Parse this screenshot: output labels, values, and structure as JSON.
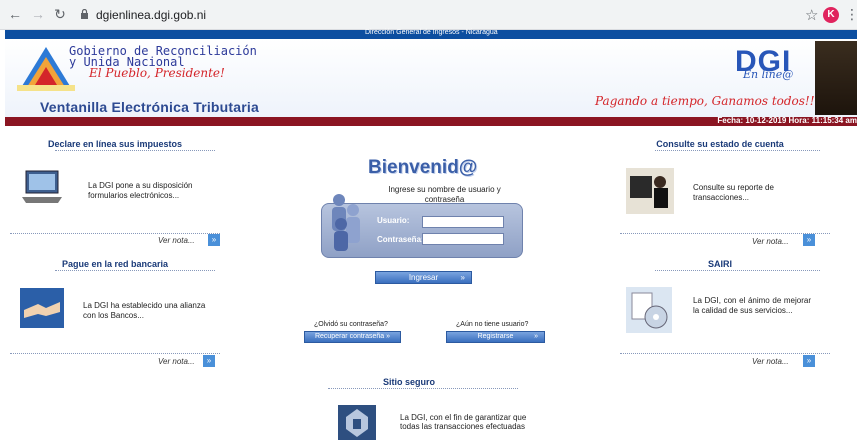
{
  "browser": {
    "url": "dgienlinea.dgi.gob.ni",
    "profile_initial": "K"
  },
  "site": {
    "top_strip": "Dirección General de Ingresos - Nicaragua",
    "gov_line1": "Gobierno de Reconciliación",
    "gov_line2": "y Unida Nacional",
    "gov_line3": "El Pueblo, Presidente!",
    "portal_title": "Ventanilla Electrónica Tributaria",
    "dgi_logo": "DGI",
    "dgi_sub": "En line@",
    "slogan": "Pagando a tiempo, Ganamos todos!!",
    "date_line": "Fecha: 10-12-2019 Hora: 11:15:34 am"
  },
  "left": {
    "box1": {
      "title": "Declare en línea sus impuestos",
      "desc": "La DGI pone a su disposición formularios electrónicos...",
      "more": "Ver nota..."
    },
    "box2": {
      "title": "Pague en la red bancaria",
      "desc": "La DGI ha establecido una alianza con los Bancos...",
      "more": "Ver nota..."
    }
  },
  "right": {
    "box1": {
      "title": "Consulte su estado de cuenta",
      "desc": "Consulte su reporte de transacciones...",
      "more": "Ver nota..."
    },
    "box2": {
      "title": "SAIRI",
      "desc": "La DGI, con el ánimo de mejorar la calidad de sus servicios...",
      "more": "Ver nota..."
    }
  },
  "login": {
    "title": "Bienvenid@",
    "hint": "Ingrese su nombre de usuario y contraseña",
    "user_label": "Usuario:",
    "pass_label": "Contraseña:",
    "user_value": "",
    "pass_value": "",
    "submit": "Ingresar",
    "forgot_q": "¿Olvidó su contraseña?",
    "forgot_btn": "Recuperar contraseña",
    "register_q": "¿Aún no tiene usuario?",
    "register_btn": "Registrarse"
  },
  "secure": {
    "title": "Sitio seguro",
    "desc": "La DGI, con el fin de garantizar que todas las transacciones efectuadas"
  }
}
